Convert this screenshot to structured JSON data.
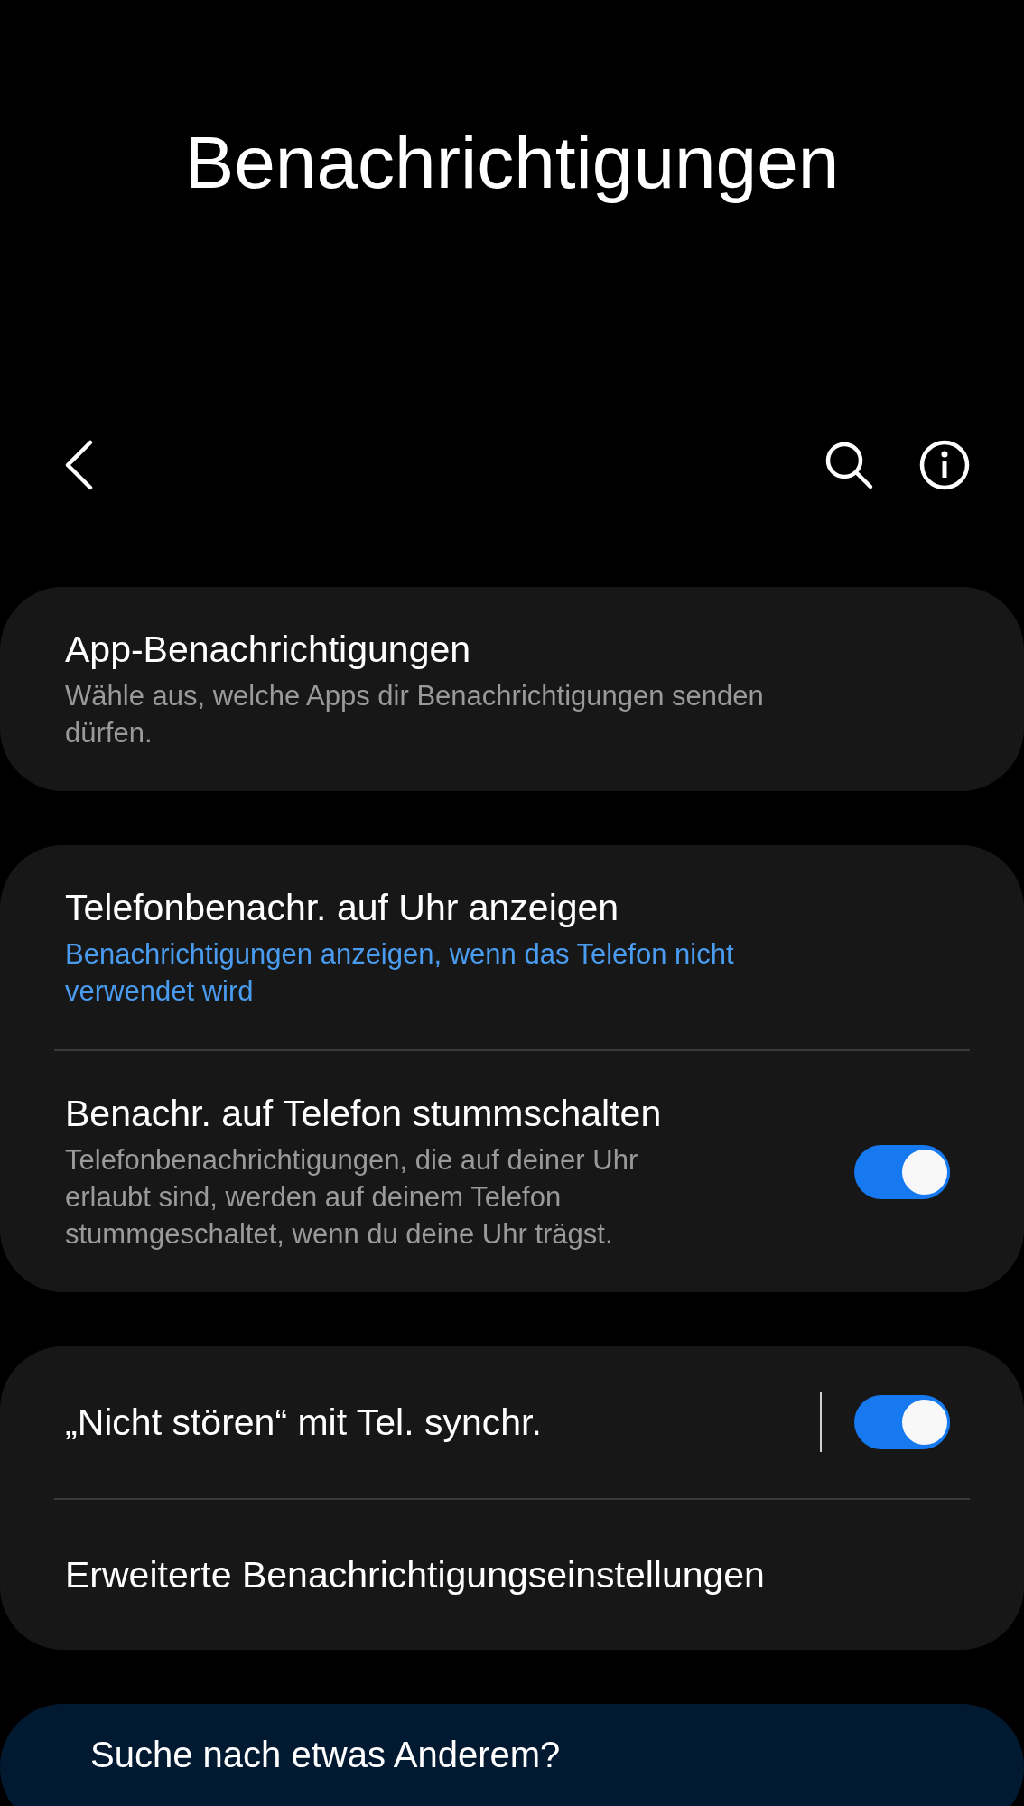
{
  "header": {
    "title": "Benachrichtigungen"
  },
  "groups": [
    {
      "items": [
        {
          "kind": "link",
          "title": "App-Benachrichtigungen",
          "subtitle": "Wähle aus, welche Apps dir Benachrichtigungen senden dürfen.",
          "highlighted": false
        }
      ]
    },
    {
      "items": [
        {
          "kind": "link",
          "title": "Telefonbenachr. auf Uhr anzeigen",
          "subtitle": "Benachrichtigungen anzeigen, wenn das Telefon nicht verwendet wird",
          "highlighted": true
        },
        {
          "kind": "switch",
          "title": "Benachr. auf Telefon stummschalten",
          "subtitle": "Telefonbenachrichtigungen, die auf deiner Uhr erlaubt sind, werden auf deinem Telefon stummgeschaltet, wenn du deine Uhr trägst.",
          "highlighted": false,
          "on": true,
          "split": false
        }
      ]
    },
    {
      "items": [
        {
          "kind": "switch",
          "title": "„Nicht stören“ mit Tel. synchr.",
          "on": true,
          "split": true
        },
        {
          "kind": "link",
          "title": "Erweiterte Benachrichtigungseinstellungen"
        }
      ]
    }
  ],
  "suggestion": {
    "title": "Suche nach etwas Anderem?"
  }
}
